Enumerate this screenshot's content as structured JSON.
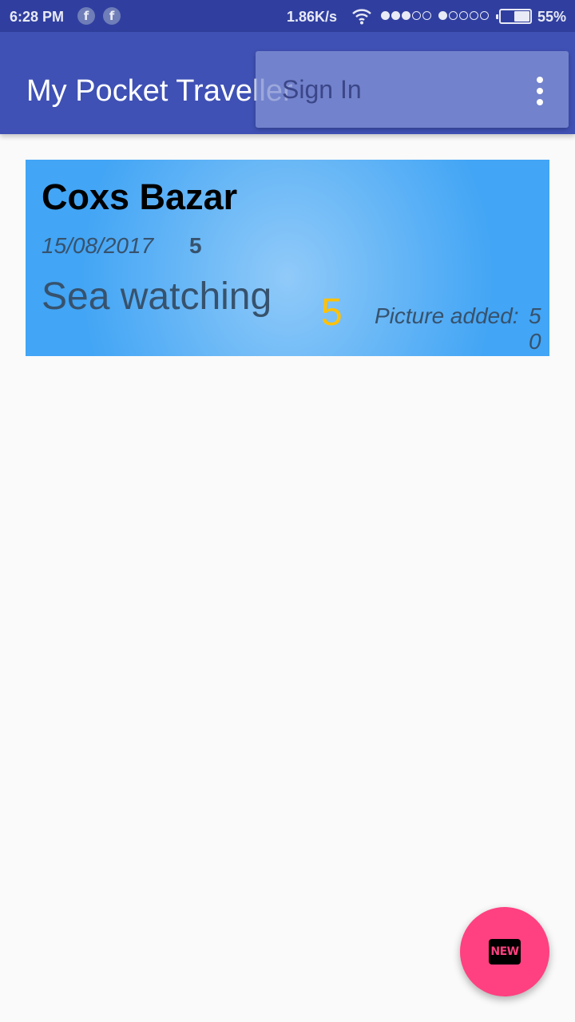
{
  "status_bar": {
    "time": "6:28 PM",
    "notification_icons": [
      "facebook-icon",
      "facebook-icon"
    ],
    "fb_glyph": "f",
    "net_speed": "1.86K/s",
    "sim1_signal": 3,
    "sim2_signal": 1,
    "signal_max": 5,
    "battery_level": 0.55,
    "battery_text": "55%"
  },
  "app_bar": {
    "title": "My Pocket Traveller",
    "color": "#3f51b5",
    "overflow_icon": "more-vert-icon"
  },
  "menu": {
    "sign_in_label": "Sign In"
  },
  "trips": [
    {
      "title": "Coxs Bazar",
      "date": "15/08/2017",
      "days": "5",
      "description": "Sea watching",
      "rating": "5",
      "pictures_label": "Picture added:",
      "pictures_count": "50"
    }
  ],
  "fab": {
    "icon": "new-icon",
    "label": "NEW",
    "color": "#ff4081"
  }
}
